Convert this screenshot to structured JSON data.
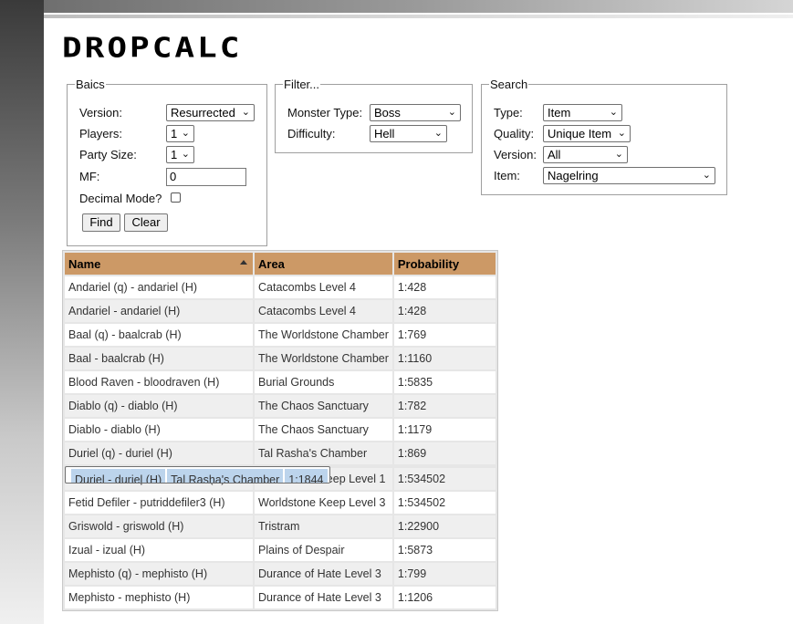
{
  "logo": "DROPCALC",
  "basics": {
    "legend": "Baics",
    "version_label": "Version:",
    "version_value": "Resurrected",
    "players_label": "Players:",
    "players_value": "1",
    "party_label": "Party Size:",
    "party_value": "1",
    "mf_label": "MF:",
    "mf_value": "0",
    "decimal_label": "Decimal Mode?",
    "decimal_checked": false,
    "find_label": "Find",
    "clear_label": "Clear"
  },
  "filter": {
    "legend": "Filter...",
    "monster_type_label": "Monster Type:",
    "monster_type_value": "Boss",
    "difficulty_label": "Difficulty:",
    "difficulty_value": "Hell"
  },
  "search": {
    "legend": "Search",
    "type_label": "Type:",
    "type_value": "Item",
    "quality_label": "Quality:",
    "quality_value": "Unique Item",
    "version_label": "Version:",
    "version_value": "All",
    "item_label": "Item:",
    "item_value": "Nagelring"
  },
  "table": {
    "headers": [
      "Name",
      "Area",
      "Probability"
    ],
    "sort_column": "Name",
    "rows": [
      [
        "Andariel (q) - andariel (H)",
        "Catacombs Level 4",
        "1:428"
      ],
      [
        "Andariel - andariel (H)",
        "Catacombs Level 4",
        "1:428"
      ],
      [
        "Baal (q) - baalcrab (H)",
        "The Worldstone Chamber",
        "1:769"
      ],
      [
        "Baal - baalcrab (H)",
        "The Worldstone Chamber",
        "1:1160"
      ],
      [
        "Blood Raven - bloodraven (H)",
        "Burial Grounds",
        "1:5835"
      ],
      [
        "Diablo (q) - diablo (H)",
        "The Chaos Sanctuary",
        "1:782"
      ],
      [
        "Diablo - diablo (H)",
        "The Chaos Sanctuary",
        "1:1179"
      ],
      [
        "Duriel (q) - duriel (H)",
        "Tal Rasha's Chamber",
        "1:869"
      ],
      [
        "Duriel - duriel (H)",
        "Tal Rasha's Chamber",
        "1:1844"
      ],
      [
        "Fetid Defiler - putriddefiler3 (H)",
        "Worldstone Keep Level 1",
        "1:534502"
      ],
      [
        "Fetid Defiler - putriddefiler3 (H)",
        "Worldstone Keep Level 3",
        "1:534502"
      ],
      [
        "Griswold - griswold (H)",
        "Tristram",
        "1:22900"
      ],
      [
        "Izual - izual (H)",
        "Plains of Despair",
        "1:5873"
      ],
      [
        "Mephisto (q) - mephisto (H)",
        "Durance of Hate Level 3",
        "1:799"
      ],
      [
        "Mephisto - mephisto (H)",
        "Durance of Hate Level 3",
        "1:1206"
      ]
    ],
    "selected_row": 8
  },
  "colors": {
    "header_bg": "#cc9966",
    "row_alt_bg": "#efefef",
    "row_selected_bg": "#bcd4ec"
  }
}
